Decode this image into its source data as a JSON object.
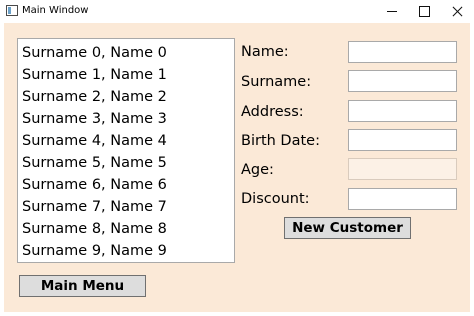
{
  "window": {
    "title": "Main Window",
    "icon": "app-window-icon"
  },
  "controls": {
    "minimize": "minimize-icon",
    "maximize": "maximize-icon",
    "close": "close-icon"
  },
  "customer_list": {
    "items": [
      "Surname 0, Name 0",
      "Surname 1, Name 1",
      "Surname 2, Name 2",
      "Surname 3, Name 3",
      "Surname 4, Name 4",
      "Surname 5, Name 5",
      "Surname 6, Name 6",
      "Surname 7, Name 7",
      "Surname 8, Name 8",
      "Surname 9, Name 9"
    ]
  },
  "form": {
    "name_label": "Name:",
    "name_value": "",
    "surname_label": "Surname:",
    "surname_value": "",
    "address_label": "Address:",
    "address_value": "",
    "birth_date_label": "Birth Date:",
    "birth_date_value": "",
    "age_label": "Age:",
    "age_value": "",
    "discount_label": "Discount:",
    "discount_value": ""
  },
  "buttons": {
    "new_customer": "New Customer",
    "main_menu": "Main Menu"
  },
  "colors": {
    "client_background": "#fbe9d7",
    "button_face": "#dddddd"
  }
}
